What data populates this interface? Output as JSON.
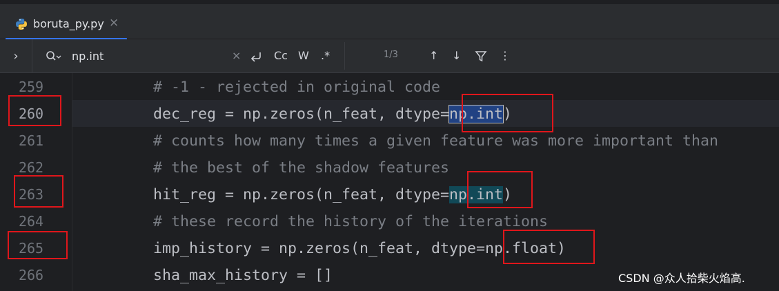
{
  "tab": {
    "filename": "boruta_py.py",
    "close": "×"
  },
  "findbar": {
    "expand": "›",
    "query": "np.int",
    "clear": "×",
    "match_case": "Cc",
    "words": "W",
    "regex": ".*",
    "count": "1/3",
    "prev": "↑",
    "next": "↓",
    "more": "⋮"
  },
  "editor": {
    "lines": [
      {
        "num": "259",
        "segments": [
          {
            "t": "# -1 - rejected in original code",
            "c": "cmt"
          }
        ]
      },
      {
        "num": "260",
        "segments": [
          {
            "t": "dec_reg = np.zeros(n_feat, dtype=",
            "c": ""
          },
          {
            "t": "np.int",
            "c": "hl-sel"
          },
          {
            "t": ")",
            "c": ""
          }
        ]
      },
      {
        "num": "261",
        "segments": [
          {
            "t": "# counts how many times a given feature was more important than",
            "c": "cmt"
          }
        ]
      },
      {
        "num": "262",
        "segments": [
          {
            "t": "# the best of the shadow features",
            "c": "cmt"
          }
        ]
      },
      {
        "num": "263",
        "segments": [
          {
            "t": "hit_reg = np.zeros(n_feat, dtype=",
            "c": ""
          },
          {
            "t": "np.int",
            "c": "hl-find"
          },
          {
            "t": ")",
            "c": ""
          }
        ]
      },
      {
        "num": "264",
        "segments": [
          {
            "t": "# these record the history of the iterations",
            "c": "cmt"
          }
        ]
      },
      {
        "num": "265",
        "segments": [
          {
            "t": "imp_history = np.zeros(n_feat, dtype=np.float)",
            "c": ""
          }
        ]
      },
      {
        "num": "266",
        "segments": [
          {
            "t": "sha_max_history = []",
            "c": ""
          }
        ]
      }
    ]
  },
  "watermark": "CSDN @众人拾柴火焰高.",
  "colors": {
    "accent": "#3574f0",
    "annotation": "#e0161b",
    "selection": "#214283",
    "match": "#114957"
  }
}
